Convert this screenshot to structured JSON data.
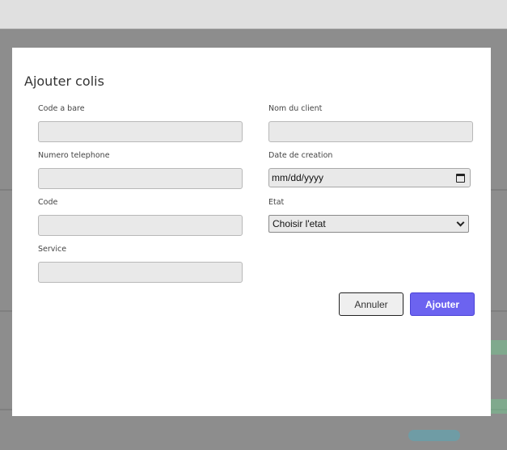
{
  "modal": {
    "title": "Ajouter colis",
    "fields": {
      "barcode": {
        "label": "Code a bare",
        "value": ""
      },
      "client_name": {
        "label": "Nom du client",
        "value": ""
      },
      "phone": {
        "label": "Numero telephone",
        "value": ""
      },
      "creation_date": {
        "label": "Date de creation",
        "placeholder": "mm/dd/yyyy"
      },
      "code": {
        "label": "Code",
        "value": ""
      },
      "state": {
        "label": "Etat",
        "selected": "Choisir l'etat"
      },
      "service": {
        "label": "Service",
        "value": ""
      }
    },
    "buttons": {
      "cancel": "Annuler",
      "submit": "Ajouter"
    }
  },
  "colors": {
    "primary": "#6c63f0",
    "input_bg": "#e9e9e9"
  },
  "icons": {
    "date": "calendar-icon",
    "select": "chevron-down-icon"
  }
}
